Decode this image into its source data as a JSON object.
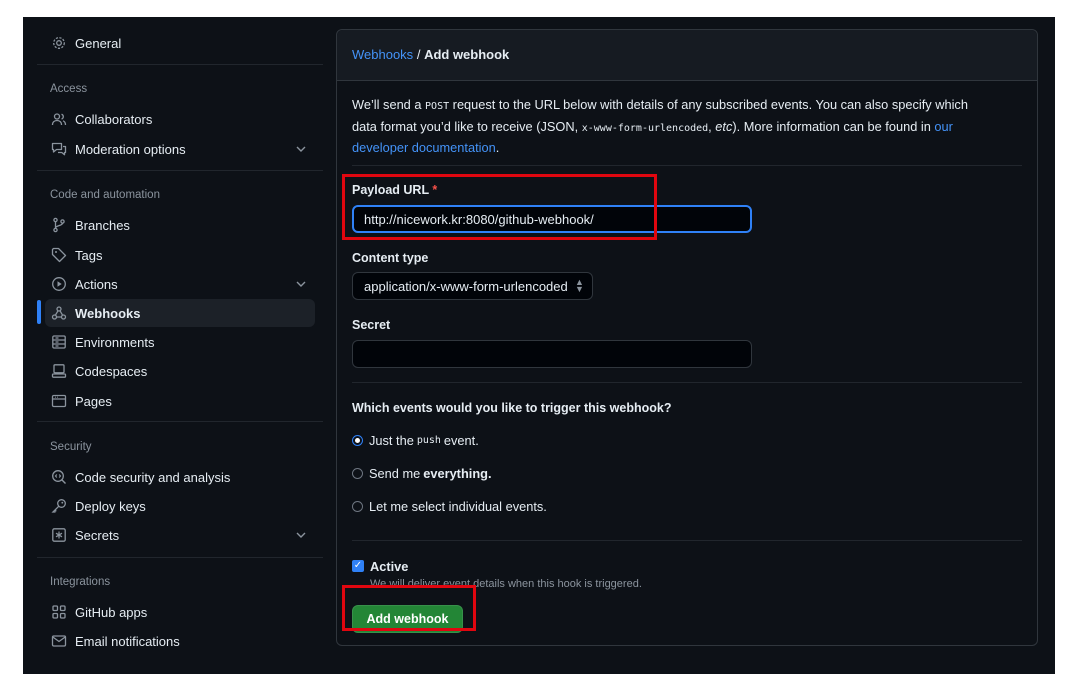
{
  "sidebar": {
    "general": "General",
    "sections": {
      "access": "Access",
      "code_automation": "Code and automation",
      "security": "Security",
      "integrations": "Integrations"
    },
    "items": {
      "collaborators": "Collaborators",
      "moderation": "Moderation options",
      "branches": "Branches",
      "tags": "Tags",
      "actions": "Actions",
      "webhooks": "Webhooks",
      "environments": "Environments",
      "codespaces": "Codespaces",
      "pages": "Pages",
      "code_security": "Code security and analysis",
      "deploy_keys": "Deploy keys",
      "secrets": "Secrets",
      "github_apps": "GitHub apps",
      "email_notifications": "Email notifications"
    },
    "selected": "webhooks"
  },
  "breadcrumb": {
    "parent": "Webhooks",
    "separator": "/",
    "current": "Add webhook"
  },
  "intro": {
    "t1": "We’ll send a ",
    "post": "POST",
    "t2": " request to the URL below with details of any subscribed events. You can also specify which data format you’d like to receive (JSON, ",
    "format": "x-www-form-urlencoded",
    "t3": ", ",
    "etc": "etc",
    "t4": "). More information can be found in ",
    "link": "our developer documentation",
    "t5": "."
  },
  "form": {
    "payload_label": "Payload URL",
    "required_mark": "*",
    "payload_value": "http://nicework.kr:8080/github-webhook/",
    "content_type_label": "Content type",
    "content_type_value": "application/x-www-form-urlencoded",
    "secret_label": "Secret",
    "secret_value": "",
    "events_question": "Which events would you like to trigger this webhook?",
    "events": {
      "push_pre": "Just the",
      "push_code": "push",
      "push_post": "event.",
      "everything_pre": "Send me",
      "everything_bold": "everything.",
      "individual": "Let me select individual events."
    },
    "active_label": "Active",
    "active_note": "We will deliver event details when this hook is triggered.",
    "submit": "Add webhook"
  },
  "colors": {
    "background": "#0d1117",
    "accent": "#2f81f7",
    "link": "#4493f8",
    "primary_button": "#238636",
    "annotation": "#e0060f"
  }
}
